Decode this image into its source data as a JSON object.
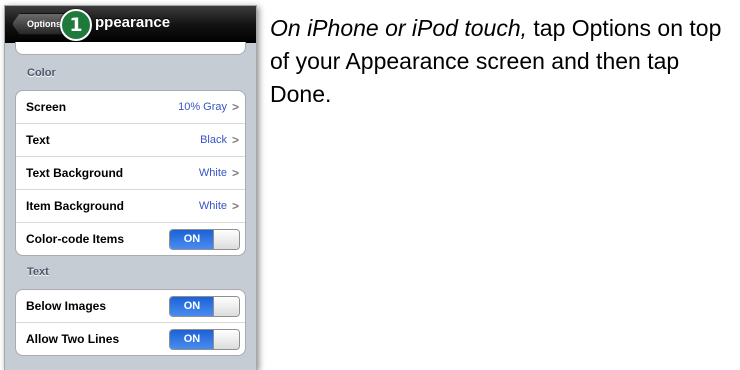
{
  "navbar": {
    "back_label": "Options",
    "title": "ppearance",
    "step_number": "1"
  },
  "sections": [
    {
      "header": "Color",
      "rows": [
        {
          "label": "Screen",
          "value": "10% Gray",
          "type": "disclosure"
        },
        {
          "label": "Text",
          "value": "Black",
          "type": "disclosure"
        },
        {
          "label": "Text Background",
          "value": "White",
          "type": "disclosure"
        },
        {
          "label": "Item Background",
          "value": "White",
          "type": "disclosure"
        },
        {
          "label": "Color-code Items",
          "value": "ON",
          "type": "toggle"
        }
      ]
    },
    {
      "header": "Text",
      "rows": [
        {
          "label": "Below Images",
          "value": "ON",
          "type": "toggle"
        },
        {
          "label": "Allow Two Lines",
          "value": "ON",
          "type": "toggle"
        }
      ]
    }
  ],
  "chevron_glyph": ">",
  "instruction": {
    "italic": "On iPhone or iPod touch,",
    "text": " tap Options on top of your Appearance screen and then tap Done."
  }
}
